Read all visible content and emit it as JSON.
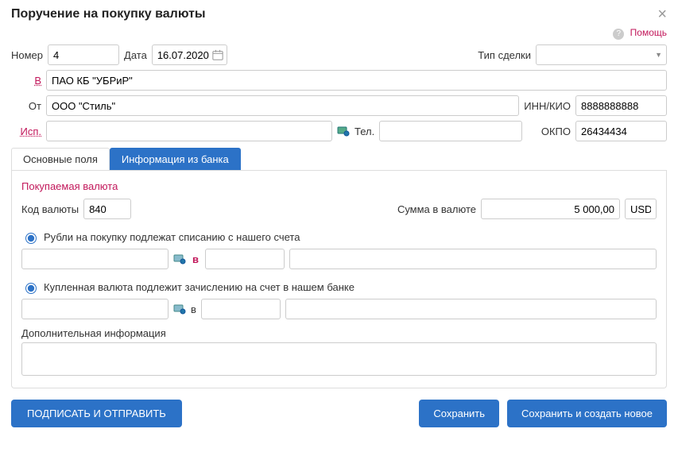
{
  "dialog": {
    "title": "Поручение на покупку валюты",
    "help": "Помощь"
  },
  "header": {
    "number_label": "Номер",
    "number": "4",
    "date_label": "Дата",
    "date": "16.07.2020",
    "deal_type_label": "Тип сделки",
    "deal_type": ""
  },
  "bank": {
    "v_label": "В",
    "name": "ПАО КБ \"УБРиР\""
  },
  "from": {
    "label": "От",
    "name": "ООО \"Стиль\"",
    "inn_label": "ИНН/КИО",
    "inn": "8888888888"
  },
  "exec": {
    "label": "Исп.",
    "name": "",
    "tel_label": "Тел.",
    "tel": "",
    "okpo_label": "ОКПО",
    "okpo": "26434434"
  },
  "tabs": {
    "main": "Основные поля",
    "bank_info": "Информация из банка"
  },
  "currency": {
    "section": "Покупаемая валюта",
    "code_label": "Код валюты",
    "code": "840",
    "amount_label": "Сумма в валюте",
    "amount": "5 000,00",
    "unit": "USD"
  },
  "ruble": {
    "radio_label": "Рубли на покупку подлежат списанию с нашего счета",
    "v_label": "в"
  },
  "bought": {
    "radio_label": "Купленная валюта подлежит зачислению на счет в нашем банке",
    "v_label": "в"
  },
  "addinfo_label": "Дополнительная информация",
  "buttons": {
    "sign": "ПОДПИСАТЬ И ОТПРАВИТЬ",
    "save": "Сохранить",
    "save_new": "Сохранить и создать новое"
  }
}
